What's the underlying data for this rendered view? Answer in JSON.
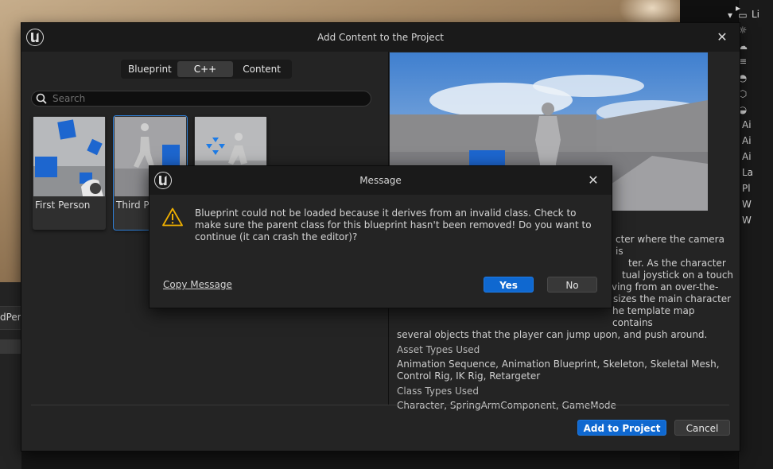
{
  "background": {
    "left_tab_text": "dPers",
    "outliner_rows": [
      {
        "icon": "folder-icon",
        "label": "Li"
      },
      {
        "icon": "sun-icon",
        "label": ""
      },
      {
        "icon": "cloud-icon",
        "label": ""
      },
      {
        "icon": "fog-icon",
        "label": ""
      },
      {
        "icon": "sky-icon",
        "label": ""
      },
      {
        "icon": "cube-icon",
        "label": ""
      },
      {
        "icon": "sphere-icon",
        "label": ""
      },
      {
        "icon": "actor-icon",
        "label": "Ai"
      },
      {
        "icon": "actor-icon",
        "label": "Ai"
      },
      {
        "icon": "actor-icon",
        "label": "Ai"
      },
      {
        "icon": "landscape-icon",
        "label": "La"
      },
      {
        "icon": "player-start-icon",
        "label": "Pl"
      },
      {
        "icon": "sphere-icon",
        "label": "W"
      },
      {
        "icon": "sphere-icon",
        "label": "W"
      }
    ]
  },
  "dialog": {
    "title": "Add Content to the Project",
    "tabs": [
      {
        "label": "Blueprint",
        "active": false
      },
      {
        "label": "C++",
        "active": true
      },
      {
        "label": "Content",
        "active": false
      }
    ],
    "search_placeholder": "Search",
    "templates": [
      {
        "label": "First Person",
        "selected": false
      },
      {
        "label": "Third Person",
        "selected": true
      },
      {
        "label": "",
        "selected": false
      }
    ],
    "description": {
      "text_lines": [
        "cter where the camera is",
        "ter. As the character",
        "tual joystick on a touch",
        "ving from an over-the-",
        "sizes the main character",
        "he template map contains",
        "several objects that the player can jump upon, and push around."
      ],
      "asset_types_heading": "Asset Types Used",
      "asset_types": "Animation Sequence, Animation Blueprint, Skeleton, Skeletal Mesh, Control Rig, IK Rig, Retargeter",
      "class_types_heading": "Class Types Used",
      "class_types": "Character, SpringArmComponent, GameMode"
    },
    "add_button": "Add to Project",
    "cancel_button": "Cancel"
  },
  "message": {
    "title": "Message",
    "body": "Blueprint could not be loaded because it derives from an invalid class.  Check to make sure the parent class for this blueprint hasn't been removed! Do you want to continue (it can crash the editor)?",
    "copy_label": "Copy Message",
    "yes_label": "Yes",
    "no_label": "No"
  },
  "colors": {
    "accent": "#0f68d0",
    "warning": "#f0b000",
    "panel": "#242424",
    "titlebar": "#1a1a1a"
  }
}
